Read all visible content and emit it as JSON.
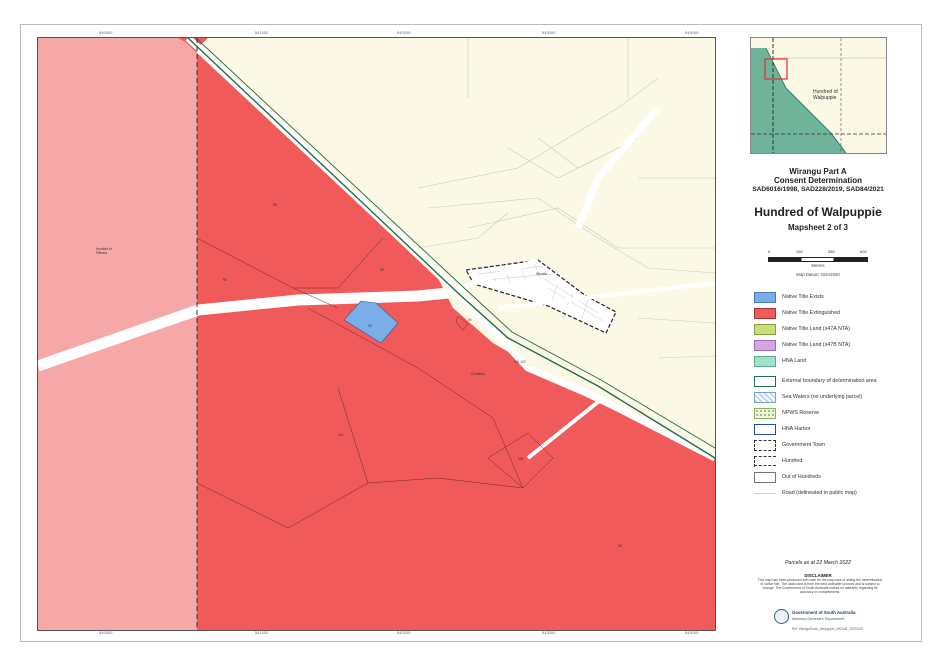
{
  "title": {
    "line1": "Wirangu Part A",
    "line2": "Consent Determination",
    "line3": "SAD6016/1998, SAD228/2019, SAD84/2021",
    "main": "Hundred of Walpuppie",
    "sheet": "Mapsheet 2 of 3"
  },
  "scale_bar": {
    "ticks": [
      "0",
      "190",
      "380",
      "600"
    ],
    "unit": "Metres",
    "datum": "Map Datum: GDA2020"
  },
  "legend": [
    {
      "label": "Native Title Exists",
      "color": "#7aaee8",
      "style": "fill"
    },
    {
      "label": "Native Title Extinguished",
      "color": "#f05a5a",
      "style": "fill"
    },
    {
      "label": "Native Title Land (s47A NTA)",
      "color": "#c6e07a",
      "style": "fill"
    },
    {
      "label": "Native Title Land (s47B NTA)",
      "color": "#d4a6e6",
      "style": "fill"
    },
    {
      "label": "HNA Land",
      "color": "#9fe3cc",
      "style": "fill"
    },
    {
      "label": "External boundary of determination area",
      "color": "#1f6e4a",
      "style": "outline"
    },
    {
      "label": "Sea Waters (no underlying parcel)",
      "color": "#bcd8ee",
      "style": "hatch"
    },
    {
      "label": "NPWS Reserve",
      "color": "#d6ebb0",
      "style": "dots"
    },
    {
      "label": "HNA Harbor",
      "color": "#234f9a",
      "style": "outline"
    },
    {
      "label": "Government Town",
      "color": "#333333",
      "style": "dashed"
    },
    {
      "label": "Hundred",
      "color": "#333333",
      "style": "dashedline"
    },
    {
      "label": "Out of Hundreds",
      "color": "#777777",
      "style": "outline"
    },
    {
      "label": "Road (delineated in public map)",
      "color": "#cccccc",
      "style": "line"
    }
  ],
  "map": {
    "colors": {
      "background": "#fbf8e6",
      "extinguished": "#f05a5a",
      "extinguished_other_hundred": "#f6a8a8",
      "exists": "#7aaee8",
      "boundary": "#1f6e4a",
      "road": "#ffffff"
    },
    "top_ticks": [
      "540000",
      "541000",
      "542000",
      "543000",
      "544000"
    ],
    "bottom_ticks": [
      "540000",
      "541000",
      "542000",
      "543000",
      "544000"
    ],
    "hundred_left": "Hundred of\nPilbrara",
    "town": "Wirrulla",
    "parcel_labels": [
      "98",
      "96",
      "99",
      "95",
      "94",
      "100",
      "104",
      "101",
      "106",
      "106",
      "96"
    ],
    "other_labels": [
      "102-103",
      "Church",
      "Cemetery"
    ]
  },
  "inset": {
    "label_line1": "Hundred of",
    "label_line2": "Walpuppie",
    "colors": {
      "land": "#6fb39a",
      "outside": "#fbf8e6",
      "extent": "#e03030"
    }
  },
  "footer": {
    "parcels_date": "Parcels as at 22 March 2022",
    "disclaimer_title": "DISCLAIMER",
    "disclaimer_text": "This map has been produced with care for the purposes of aiding the determination of native title. The data used is from the best available sources and is subject to change. The Government of South Australia makes no warranty regarding its accuracy or completeness.",
    "gov_line1": "Government of South Australia",
    "gov_line2": "Attorney-General's Department",
    "ref": "Ref: WirraguPartA_Walpuppie_MS2of3_20220322"
  }
}
